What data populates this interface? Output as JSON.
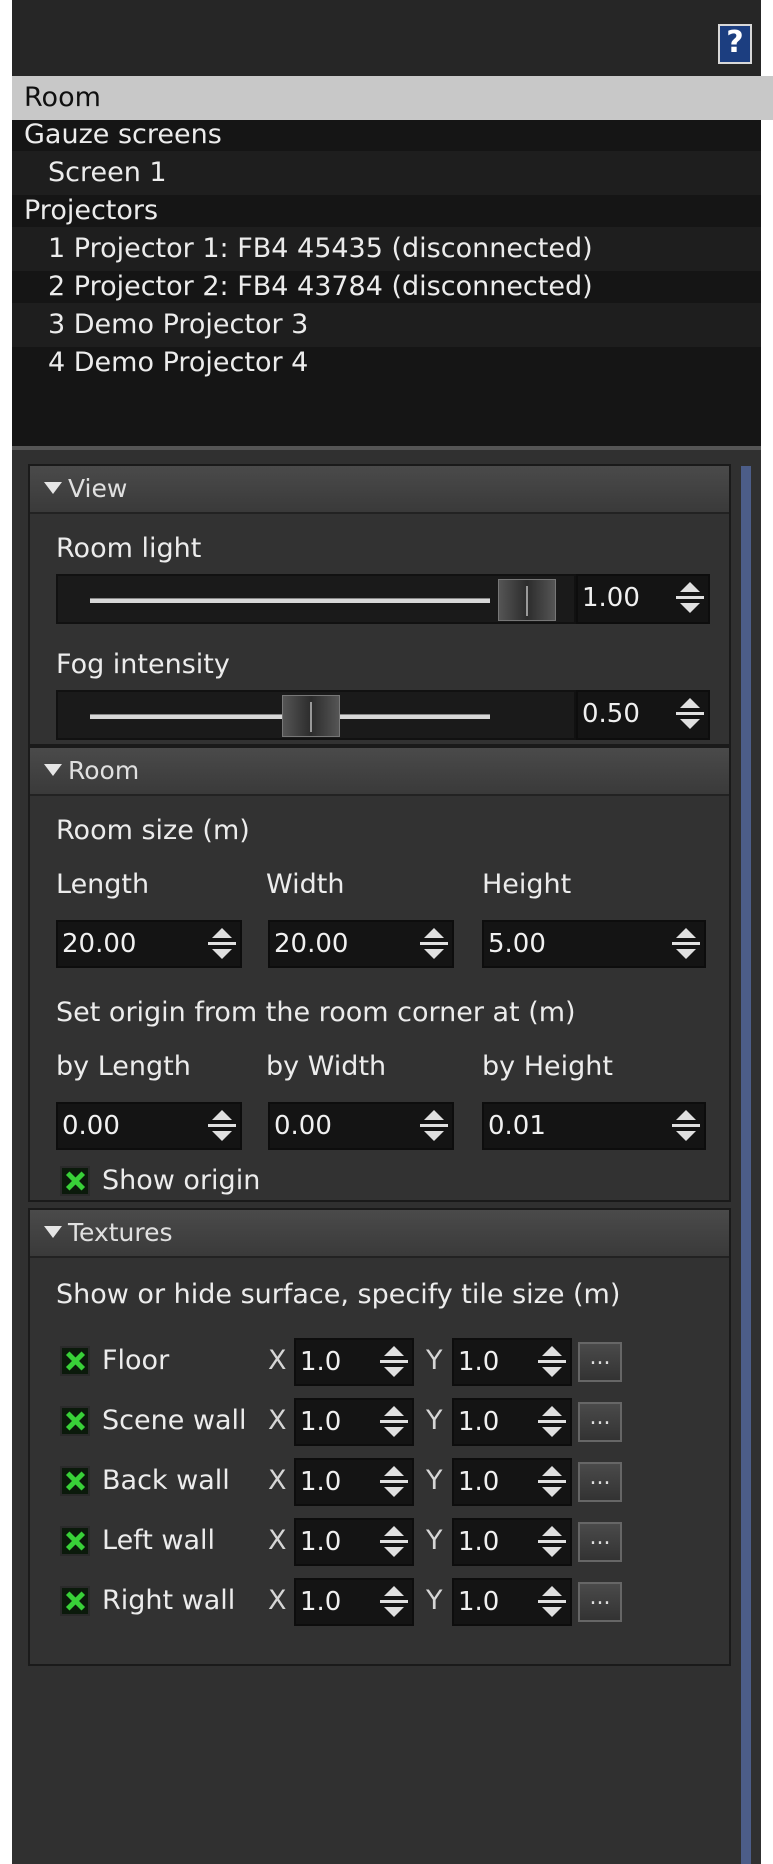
{
  "help": {
    "label": "?"
  },
  "tree": {
    "items": [
      {
        "label": "Room"
      },
      {
        "label": "Gauze screens"
      },
      {
        "label": "Screen 1"
      },
      {
        "label": "Projectors"
      },
      {
        "label": "1 Projector 1: FB4 45435 (disconnected)"
      },
      {
        "label": "2 Projector 2: FB4 43784 (disconnected)"
      },
      {
        "label": "3 Demo Projector 3"
      },
      {
        "label": "4 Demo Projector 4"
      }
    ],
    "selected_index": 0
  },
  "view": {
    "title": "View",
    "room_light": {
      "label": "Room light",
      "value": "1.00",
      "fraction": 1.0
    },
    "fog_intensity": {
      "label": "Fog intensity",
      "value": "0.50",
      "fraction": 0.5
    }
  },
  "room": {
    "title": "Room",
    "size_label": "Room size (m)",
    "length_label": "Length",
    "width_label": "Width",
    "height_label": "Height",
    "length": "20.00",
    "width": "20.00",
    "height": "5.00",
    "origin_label": "Set origin from the room corner at (m)",
    "by_length_label": "by Length",
    "by_width_label": "by Width",
    "by_height_label": "by Height",
    "by_length": "0.00",
    "by_width": "0.00",
    "by_height": "0.01",
    "show_origin_label": "Show origin",
    "show_origin_checked": true
  },
  "textures": {
    "title": "Textures",
    "description": "Show or hide surface, specify tile size (m)",
    "x_label": "X",
    "y_label": "Y",
    "browse_label": "...",
    "surfaces": [
      {
        "label": "Floor",
        "x": "1.0",
        "y": "1.0",
        "checked": true
      },
      {
        "label": "Scene wall",
        "x": "1.0",
        "y": "1.0",
        "checked": true
      },
      {
        "label": "Back wall",
        "x": "1.0",
        "y": "1.0",
        "checked": true
      },
      {
        "label": "Left wall",
        "x": "1.0",
        "y": "1.0",
        "checked": true
      },
      {
        "label": "Right wall",
        "x": "1.0",
        "y": "1.0",
        "checked": true
      }
    ]
  },
  "colors": {
    "selection": "#c8c8c8",
    "scrollbar": "#4c5d88",
    "checkmark": "#38d038",
    "help_button": "#1c3e80"
  }
}
